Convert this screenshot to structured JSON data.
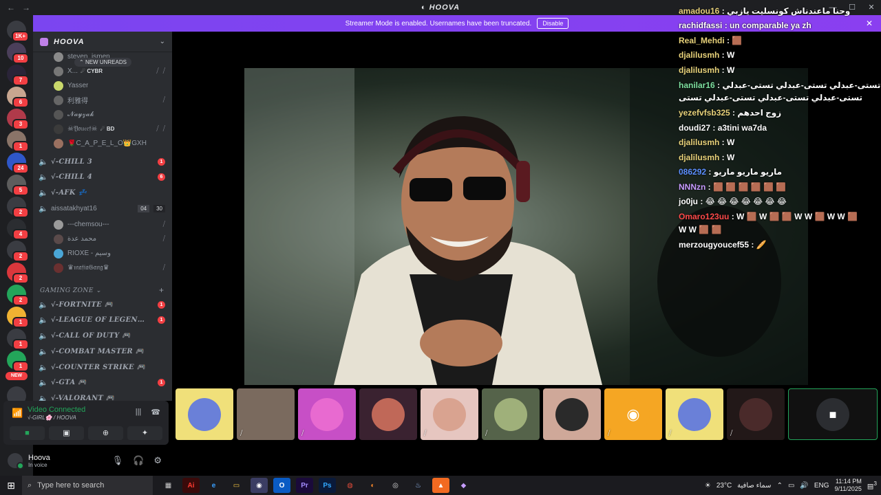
{
  "window": {
    "title": "HOOVA",
    "nav_back": "←",
    "nav_fwd": "→",
    "controls": [
      "—",
      "☐",
      "✕"
    ]
  },
  "banner": {
    "text": "Streamer Mode is enabled. Usernames have been truncated.",
    "disable_label": "Disable",
    "close": "✕"
  },
  "guild_badges": [
    "1K+",
    "10",
    "7",
    "6",
    "3",
    "1",
    "24",
    "5",
    "2",
    "4",
    "2",
    "2",
    "2",
    "1",
    "1",
    "1"
  ],
  "guild_new": "NEW",
  "server": {
    "name": "HOOVA",
    "new_unreads": "NEW UNREADS"
  },
  "members_top": [
    {
      "name": "steven_ismen",
      "tag": ""
    },
    {
      "name": "X...",
      "tag": "☄ CYBR"
    },
    {
      "name": "Yasser",
      "tag": ""
    },
    {
      "name": "利雅得",
      "tag": ""
    },
    {
      "name": "𝓝𝓪𝔂𝔃𝓪𝓴",
      "tag": ""
    },
    {
      "name": "☠𝔜𝔬𝔲𝔠𝔢𝔣☠",
      "tag": "☄ BD"
    },
    {
      "name": "🌹C_A_P_E_L_O👑GXH",
      "tag": ""
    }
  ],
  "voice_channels_a": [
    {
      "name": "√-CHILL 3",
      "badge": "1"
    },
    {
      "name": "√-CHILL 4",
      "badge": "6"
    },
    {
      "name": "√-AFK 💤",
      "badge": ""
    }
  ],
  "aissa_channel": {
    "name": "aissatakhyat16",
    "limit_a": "04",
    "limit_b": "30"
  },
  "members_bottom": [
    {
      "name": "---chemsou---"
    },
    {
      "name": "محمد عدة"
    },
    {
      "name": "RIOXE - وسيم"
    },
    {
      "name": "♛𝔪𝔞𝔣𝔦𝔞𝔊𝔞𝔫𝔤♛"
    }
  ],
  "category": {
    "name": "GAMING ZONE",
    "plus": "+"
  },
  "voice_channels_b": [
    {
      "name": "√-FORTNITE 🎮",
      "badge": "1"
    },
    {
      "name": "√-LEAGUE OF LEGENDS...",
      "badge": "1"
    },
    {
      "name": "√-CALL OF DUTY 🎮",
      "badge": ""
    },
    {
      "name": "√-COMBAT MASTER 🎮",
      "badge": ""
    },
    {
      "name": "√-COUNTER STRIKE 🎮",
      "badge": ""
    },
    {
      "name": "√-GTA 🎮",
      "badge": "1"
    },
    {
      "name": "√-VALORANT 🎮",
      "badge": ""
    }
  ],
  "voice_status": {
    "title": "Video Connected",
    "subtitle": "√-GIRL🌸 / HOOVA"
  },
  "user": {
    "name": "Hoova",
    "status": "In voice"
  },
  "chat": [
    {
      "user": "amadou16",
      "text": "وحنا ماعندناش كونسليت يازبي",
      "color": "#e8d27a"
    },
    {
      "user": "rachidfassi",
      "text": "un comparable ya zh",
      "color": "#ffffff"
    },
    {
      "user": "Real_Mehdi",
      "text": "🟫",
      "color": "#e8d27a"
    },
    {
      "user": "djalilusmh",
      "text": "W",
      "color": "#e8d27a"
    },
    {
      "user": "djalilusmh",
      "text": "W",
      "color": "#e8d27a"
    },
    {
      "user": "hanilar16",
      "text": "عبدلي تستى-عبدلي تستى-عبدلي تستى-عبدلي",
      "color": "#7ee0a0"
    },
    {
      "user": "",
      "text": "تستى-عبدلي تستى-عبدلي تستى-عبدلي تستى",
      "color": "#ffffff"
    },
    {
      "user": "yezefvfsb325",
      "text": "زوج احدهم",
      "color": "#e8d27a"
    },
    {
      "user": "doudi27",
      "text": "a3tini wa7da",
      "color": "#ffffff"
    },
    {
      "user": "djalilusmh",
      "text": "W",
      "color": "#e8d27a"
    },
    {
      "user": "djalilusmh",
      "text": "W",
      "color": "#e8d27a"
    },
    {
      "user": "086292",
      "text": "ماريو ماريو ماريو",
      "color": "#5c8fff"
    },
    {
      "user": "NNNzn",
      "text": "🟫 🟫 🟫 🟫 🟫 🟫",
      "color": "#c79bff"
    },
    {
      "user": "jo0ju",
      "text": "😂 😂 😂 😂 😂 😂 😂",
      "color": "#ffffff"
    },
    {
      "user": "Omaro123uu",
      "text": "W 🟫 W 🟫 🟫 W W 🟫 W W 🟫",
      "color": "#ff4a4a"
    },
    {
      "user": "",
      "text": "W W 🟫 🟫",
      "color": "#ffffff"
    },
    {
      "user": "merzougyoucef55",
      "text": "🥖",
      "color": "#ffffff"
    }
  ],
  "taskbar": {
    "search_placeholder": "Type here to search",
    "weather": "23°C",
    "weather_text": "سماء صافية",
    "lang": "ENG",
    "time": "11:14 PM",
    "date": "9/11/2025",
    "notif": "3",
    "apps": [
      "▦",
      "Ai",
      "e",
      "▭",
      "◉",
      "O",
      "Pr",
      "Ps",
      "◍",
      "◐",
      "◎",
      "♨",
      "▲",
      "◆"
    ]
  },
  "colors": {
    "accent": "#5865f2",
    "banner": "#7b45f0",
    "online": "#23a55a",
    "badge": "#f23f43"
  }
}
